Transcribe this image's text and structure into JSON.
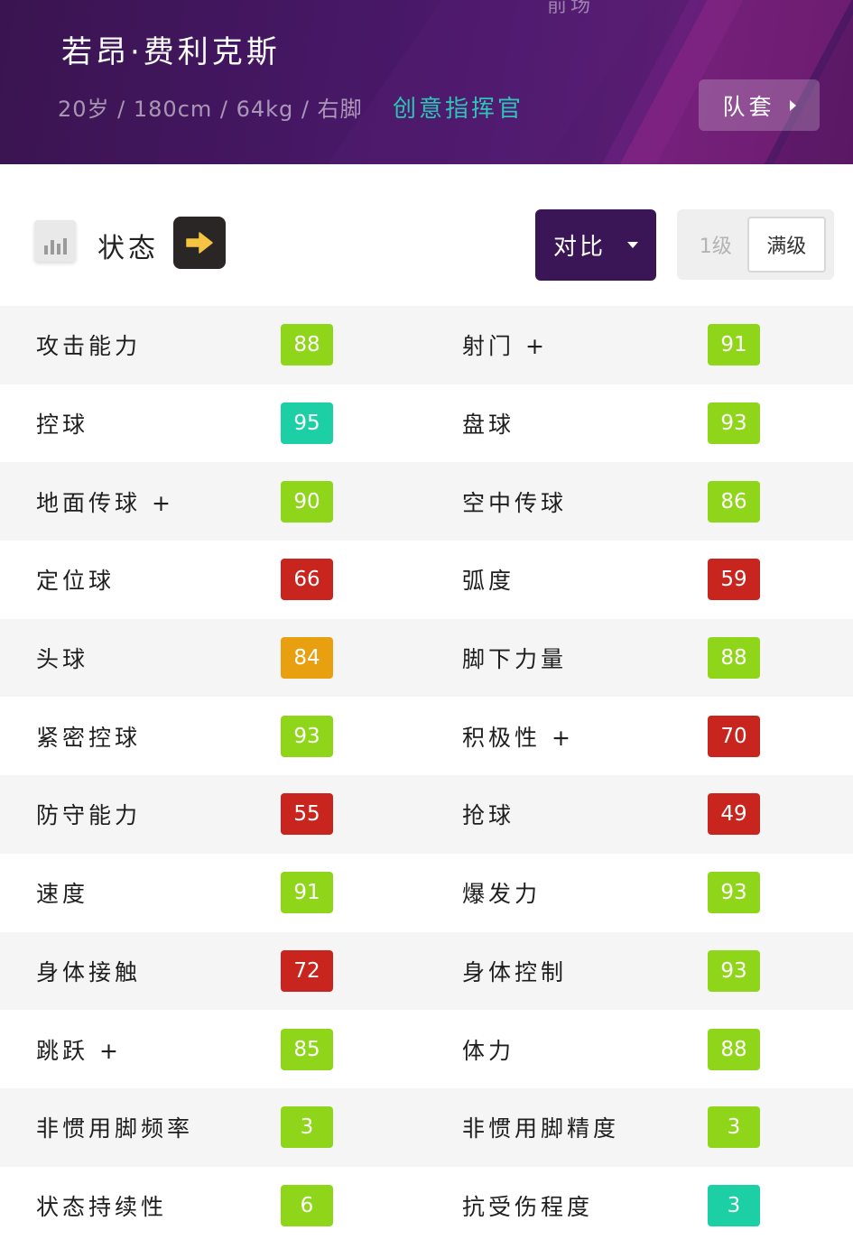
{
  "header": {
    "top_hint": "前场",
    "player_name": "若昂·费利克斯",
    "meta": "20岁 / 180cm / 64kg / 右脚",
    "role": "创意指挥官",
    "squad_button": "队套"
  },
  "toolbar": {
    "status_label": "状态",
    "compare_button": "对比",
    "level_options": [
      "1级",
      "满级"
    ],
    "selected_level": "满级"
  },
  "colors": {
    "green": "#8fd61a",
    "teal": "#1ccfa4",
    "red": "#c8251f",
    "orange": "#e8a010",
    "header_purple": "#451763",
    "compare_purple": "#3b1657",
    "role_teal": "#2ec5b8"
  },
  "stats": [
    {
      "left": {
        "label": "攻击能力",
        "value": "88",
        "color": "#8fd61a"
      },
      "right": {
        "label": "射门 +",
        "value": "91",
        "color": "#8fd61a"
      }
    },
    {
      "left": {
        "label": "控球",
        "value": "95",
        "color": "#1ccfa4"
      },
      "right": {
        "label": "盘球",
        "value": "93",
        "color": "#8fd61a"
      }
    },
    {
      "left": {
        "label": "地面传球 +",
        "value": "90",
        "color": "#8fd61a"
      },
      "right": {
        "label": "空中传球",
        "value": "86",
        "color": "#8fd61a"
      }
    },
    {
      "left": {
        "label": "定位球",
        "value": "66",
        "color": "#c8251f"
      },
      "right": {
        "label": "弧度",
        "value": "59",
        "color": "#c8251f"
      }
    },
    {
      "left": {
        "label": "头球",
        "value": "84",
        "color": "#e8a010"
      },
      "right": {
        "label": "脚下力量",
        "value": "88",
        "color": "#8fd61a"
      }
    },
    {
      "left": {
        "label": "紧密控球",
        "value": "93",
        "color": "#8fd61a"
      },
      "right": {
        "label": "积极性 +",
        "value": "70",
        "color": "#c8251f"
      }
    },
    {
      "left": {
        "label": "防守能力",
        "value": "55",
        "color": "#c8251f"
      },
      "right": {
        "label": "抢球",
        "value": "49",
        "color": "#c8251f"
      }
    },
    {
      "left": {
        "label": "速度",
        "value": "91",
        "color": "#8fd61a"
      },
      "right": {
        "label": "爆发力",
        "value": "93",
        "color": "#8fd61a"
      }
    },
    {
      "left": {
        "label": "身体接触",
        "value": "72",
        "color": "#c8251f"
      },
      "right": {
        "label": "身体控制",
        "value": "93",
        "color": "#8fd61a"
      }
    },
    {
      "left": {
        "label": "跳跃 +",
        "value": "85",
        "color": "#8fd61a"
      },
      "right": {
        "label": "体力",
        "value": "88",
        "color": "#8fd61a"
      }
    },
    {
      "left": {
        "label": "非惯用脚频率",
        "value": "3",
        "color": "#8fd61a"
      },
      "right": {
        "label": "非惯用脚精度",
        "value": "3",
        "color": "#8fd61a"
      }
    },
    {
      "left": {
        "label": "状态持续性",
        "value": "6",
        "color": "#8fd61a"
      },
      "right": {
        "label": "抗受伤程度",
        "value": "3",
        "color": "#1ccfa4"
      }
    }
  ]
}
